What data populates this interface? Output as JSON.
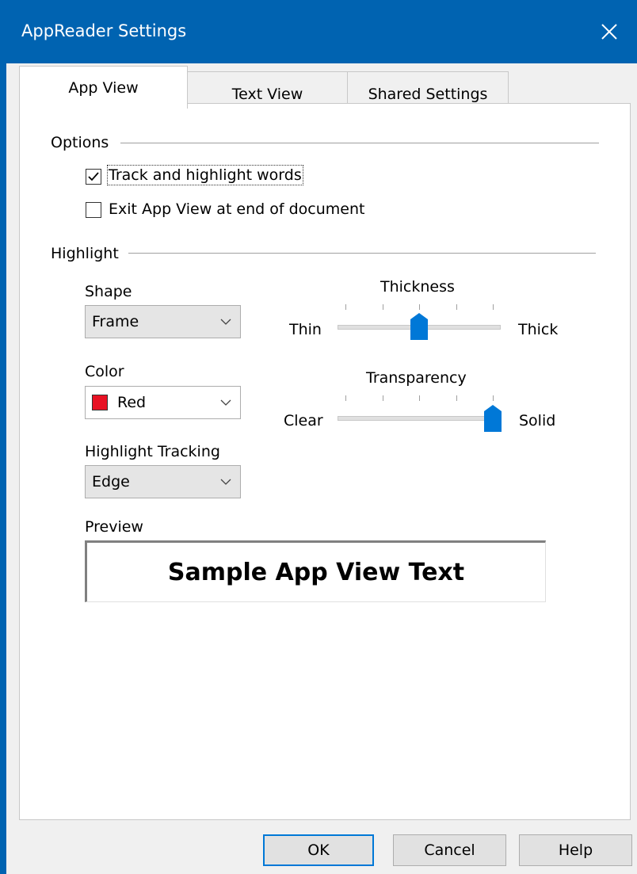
{
  "window": {
    "title": "AppReader Settings"
  },
  "tabs": [
    {
      "label": "App View"
    },
    {
      "label": "Text View"
    },
    {
      "label": "Shared Settings"
    }
  ],
  "options": {
    "group_label": "Options",
    "track_label": "Track and highlight words",
    "track_checked": true,
    "exit_label": "Exit App View at end of document",
    "exit_checked": false
  },
  "highlight": {
    "group_label": "Highlight",
    "shape_label": "Shape",
    "shape_value": "Frame",
    "color_label": "Color",
    "color_value": "Red",
    "color_swatch": "#e81123",
    "tracking_label": "Highlight Tracking",
    "tracking_value": "Edge",
    "thickness": {
      "label": "Thickness",
      "min_label": "Thin",
      "max_label": "Thick",
      "level": 0.5
    },
    "transparency": {
      "label": "Transparency",
      "min_label": "Clear",
      "max_label": "Solid",
      "level": 1.0
    }
  },
  "preview": {
    "label": "Preview",
    "text": "Sample App View Text"
  },
  "buttons": {
    "ok": "OK",
    "cancel": "Cancel",
    "help": "Help"
  },
  "colors": {
    "titlebar": "#0063b1",
    "accent": "#0078d7"
  }
}
